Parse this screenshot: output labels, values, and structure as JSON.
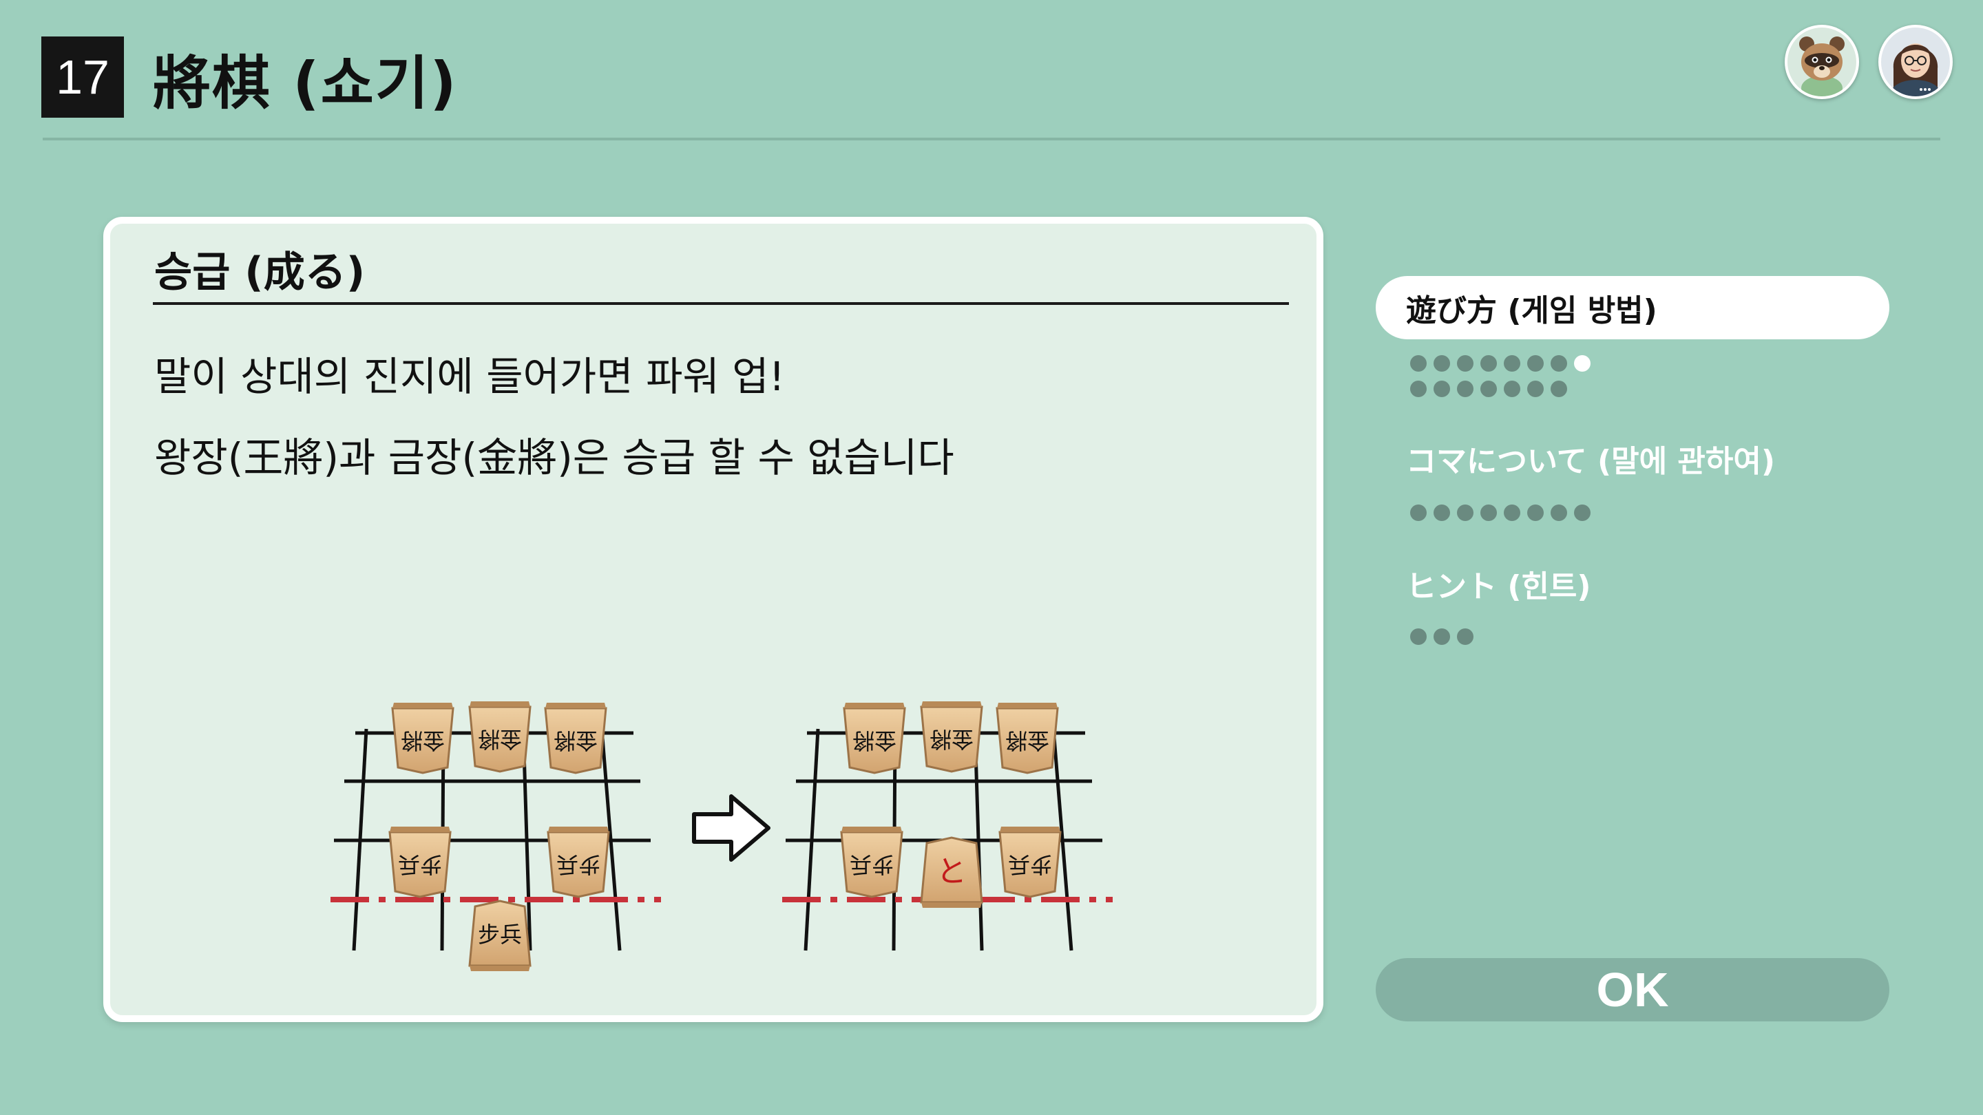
{
  "header": {
    "number": "17",
    "title": "將棋 (쇼기)"
  },
  "panel": {
    "heading": "승급 (成る)",
    "lines": [
      "말이 상대의 진지에 들어가면 파워 업!",
      "왕장(王將)과 금장(金將)은 승급 할 수 없습니다"
    ],
    "piece_chars": {
      "gold": "金將",
      "pawn": "步兵",
      "promoted": "と"
    }
  },
  "menu": {
    "items": [
      {
        "label": "遊び方 (게임 방법)",
        "active": true,
        "pages": 15,
        "current_page": 8
      },
      {
        "label": "コマについて (말에 관하여)",
        "active": false,
        "pages": 8,
        "current_page": 0
      },
      {
        "label": "ヒント (힌트)",
        "active": false,
        "pages": 3,
        "current_page": 0
      }
    ]
  },
  "ok_label": "OK",
  "colors": {
    "background": "#9dcfbd",
    "panel": "#e2f0e7",
    "dot_inactive": "#6a8a80",
    "promotion_line": "#c8323a",
    "piece_wood": "#e2bc8c",
    "promoted_text": "#c21b1b"
  },
  "icons": {
    "avatar_1": "raccoon-shopkeeper-avatar",
    "avatar_2": "player-avatar",
    "arrow": "right-arrow-icon"
  }
}
